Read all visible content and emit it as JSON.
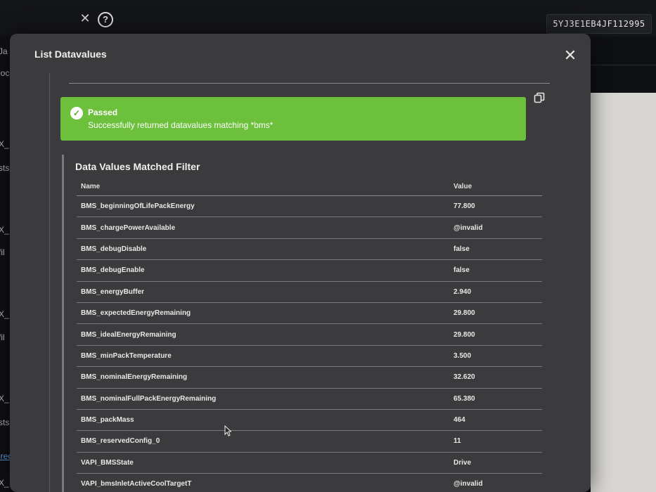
{
  "topbar": {
    "close_glyph": "✕",
    "help_glyph": "?",
    "vin": "5YJ3E1EB4JF112995"
  },
  "left_strip": [
    "Ja",
    "loc",
    "X_",
    "sts",
    "X_",
    "fil",
    "X_",
    "fil",
    "X_",
    "sts",
    "irec",
    "X_"
  ],
  "modal": {
    "title": "List Datavalues",
    "close_glyph": "✕",
    "alert": {
      "check_glyph": "✓",
      "status": "Passed",
      "message": "Successfully returned datavalues matching *bms*"
    },
    "section_title": "Data Values Matched Filter",
    "table": {
      "headers": [
        "Name",
        "Value"
      ],
      "rows": [
        {
          "name": "BMS_beginningOfLifePackEnergy",
          "value": "77.800"
        },
        {
          "name": "BMS_chargePowerAvailable",
          "value": "@invalid"
        },
        {
          "name": "BMS_debugDisable",
          "value": "false"
        },
        {
          "name": "BMS_debugEnable",
          "value": "false"
        },
        {
          "name": "BMS_energyBuffer",
          "value": "2.940"
        },
        {
          "name": "BMS_expectedEnergyRemaining",
          "value": "29.800"
        },
        {
          "name": "BMS_idealEnergyRemaining",
          "value": "29.800"
        },
        {
          "name": "BMS_minPackTemperature",
          "value": "3.500"
        },
        {
          "name": "BMS_nominalEnergyRemaining",
          "value": "32.620"
        },
        {
          "name": "BMS_nominalFullPackEnergyRemaining",
          "value": "65.380"
        },
        {
          "name": "BMS_packMass",
          "value": "464"
        },
        {
          "name": "BMS_reservedConfig_0",
          "value": "11"
        },
        {
          "name": "VAPI_BMSState",
          "value": "Drive"
        },
        {
          "name": "VAPI_bmsInletActiveCoolTargetT",
          "value": "@invalid"
        }
      ]
    }
  },
  "colors": {
    "modal_bg": "#3b3b3d",
    "success": "#6cc03c",
    "page_bg": "#0b0c0e"
  },
  "icons": {
    "copy": "copy-icon",
    "check": "check-circle-icon",
    "close": "close-icon",
    "help": "help-icon",
    "cursor": "mouse-cursor-icon"
  }
}
